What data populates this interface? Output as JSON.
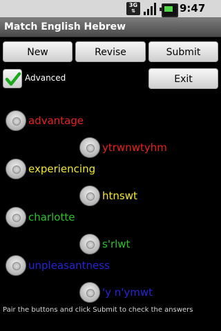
{
  "status": {
    "network": "3G",
    "time": "9:47 AM"
  },
  "title": "Match English Hebrew",
  "buttons": {
    "new": "New",
    "revise": "Revise",
    "submit": "Submit",
    "exit": "Exit"
  },
  "advanced": {
    "label": "Advanced",
    "checked": true
  },
  "pairs": [
    {
      "text": "advantage",
      "color": "#e8201c"
    },
    {
      "text": "ytrwnwtyhm",
      "color": "#e8201c"
    },
    {
      "text": "experiencing",
      "color": "#f2e82a"
    },
    {
      "text": "htnswt",
      "color": "#f2e82a"
    },
    {
      "text": "charlotte",
      "color": "#27c427"
    },
    {
      "text": "s'rlwt",
      "color": "#27c427"
    },
    {
      "text": "unpleasantness",
      "color": "#2525d6"
    },
    {
      "text": "'y n'ymwt",
      "color": "#2525d6"
    }
  ],
  "footer": "Pair the buttons and click Submit to check the answers"
}
